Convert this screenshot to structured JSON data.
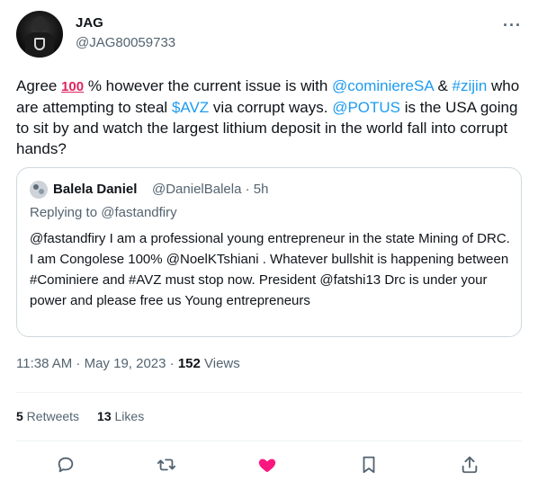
{
  "author": {
    "name": "JAG",
    "handle": "@JAG80059733"
  },
  "tweet": {
    "parts": [
      {
        "text": "Agree ",
        "type": "text"
      },
      {
        "text": "100",
        "type": "emoji"
      },
      {
        "text": " % however the current issue is with ",
        "type": "text"
      },
      {
        "text": "@cominiereSA",
        "type": "link"
      },
      {
        "text": " & ",
        "type": "text"
      },
      {
        "text": "#zijin",
        "type": "link"
      },
      {
        "text": " who are attempting to steal ",
        "type": "text"
      },
      {
        "text": "$AVZ",
        "type": "link"
      },
      {
        "text": " via corrupt ways. ",
        "type": "text"
      },
      {
        "text": "@POTUS",
        "type": "link"
      },
      {
        "text": " is the USA going to sit by and watch the largest lithium deposit in the world fall into corrupt hands?",
        "type": "text"
      }
    ]
  },
  "quote": {
    "name": "Balela Daniel",
    "meta": "@DanielBalela · 5h",
    "replying": "Replying to @fastandfiry",
    "text": "@fastandfiry I am a professional young entrepreneur in the state Mining of DRC. I am Congolese 100% @NoelKTshiani . Whatever bullshit is happening between #Cominiere and #AVZ must stop now. President @fatshi13 Drc is under your power and please free us Young entrepreneurs"
  },
  "timestamp": "11:38 AM · May 19, 2023 · ",
  "views_count": "152",
  "views_label": " Views",
  "stats": {
    "retweets_count": "5",
    "retweets_label": " Retweets",
    "likes_count": "13",
    "likes_label": " Likes"
  },
  "icons": {
    "reply": "reply-icon",
    "retweet": "retweet-icon",
    "like": "heart-icon",
    "bookmark": "bookmark-icon",
    "share": "share-icon",
    "more": "more-icon"
  },
  "colors": {
    "link": "#1d9bf0",
    "like": "#f91880",
    "secondary_text": "#536471"
  }
}
